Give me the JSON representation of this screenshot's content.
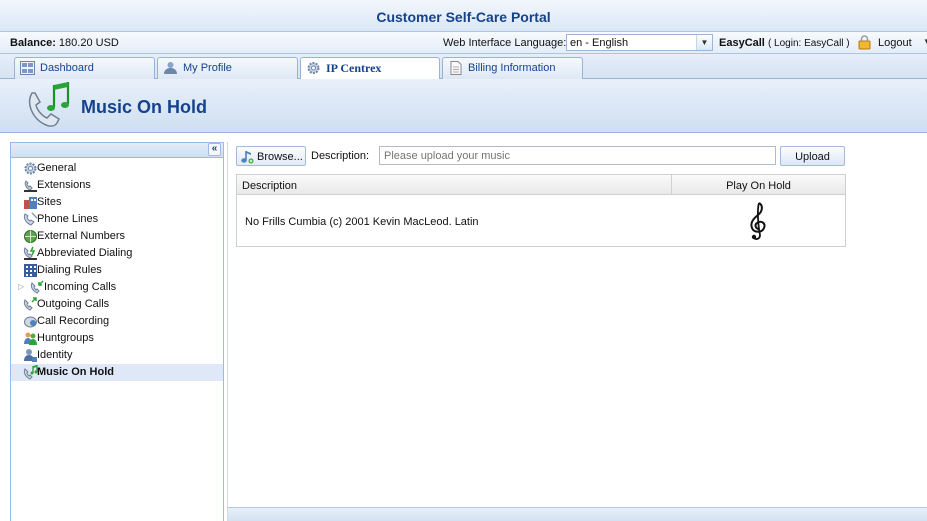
{
  "header": {
    "title": "Customer Self-Care Portal"
  },
  "infobar": {
    "balance_label": "Balance:",
    "balance_value": "180.20 USD",
    "language_label": "Web Interface Language:",
    "language_value": "en - English",
    "user_name": "EasyCall",
    "user_login": "( Login: EasyCall )",
    "logout_label": "Logout"
  },
  "tabs": [
    {
      "label": "Dashboard",
      "icon": "dashboard-icon"
    },
    {
      "label": "My Profile",
      "icon": "profile-icon"
    },
    {
      "label": "IP Centrex",
      "icon": "gear-icon",
      "active": true
    },
    {
      "label": "Billing Information",
      "icon": "document-icon"
    }
  ],
  "banner": {
    "title": "Music On Hold",
    "icon": "phone-music-icon"
  },
  "sidebar": {
    "collapse_label": "«",
    "items": [
      {
        "label": "General",
        "icon": "gear-icon"
      },
      {
        "label": "Extensions",
        "icon": "extensions-icon"
      },
      {
        "label": "Sites",
        "icon": "sites-icon"
      },
      {
        "label": "Phone Lines",
        "icon": "phone-lines-icon"
      },
      {
        "label": "External Numbers",
        "icon": "external-numbers-icon"
      },
      {
        "label": "Abbreviated Dialing",
        "icon": "abbreviated-dialing-icon"
      },
      {
        "label": "Dialing Rules",
        "icon": "dialing-rules-icon"
      },
      {
        "label": "Incoming Calls",
        "icon": "incoming-calls-icon",
        "expandable": true
      },
      {
        "label": "Outgoing Calls",
        "icon": "outgoing-calls-icon"
      },
      {
        "label": "Call Recording",
        "icon": "call-recording-icon"
      },
      {
        "label": "Huntgroups",
        "icon": "huntgroups-icon"
      },
      {
        "label": "Identity",
        "icon": "identity-icon"
      },
      {
        "label": "Music On Hold",
        "icon": "music-on-hold-icon",
        "selected": true
      }
    ]
  },
  "toolbar": {
    "browse_label": "Browse...",
    "description_label": "Description:",
    "description_placeholder": "Please upload your music",
    "upload_label": "Upload"
  },
  "grid": {
    "columns": [
      "Description",
      "Play On Hold"
    ],
    "rows": [
      {
        "description": "No Frills Cumbia (c) 2001 Kevin MacLeod. Latin",
        "play_icon": "treble-clef-icon"
      }
    ]
  },
  "colors": {
    "accent": "#15428b",
    "panel_border": "#99bbe8",
    "selected_row": "#dfe8f6"
  }
}
